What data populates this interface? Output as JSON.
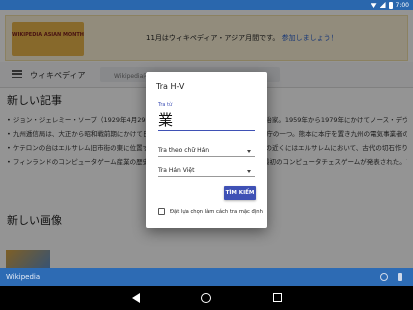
{
  "status_bar": {
    "time": "7:00"
  },
  "banner": {
    "logo_text": "WIKIPEDIA ASIAN MONTH",
    "message": "11月はウィキペディア・アジア月間です。",
    "link": "参加しましょう！"
  },
  "wiki_header": {
    "title": "ウィキペディア",
    "search_placeholder": "Wikipedia内を検索"
  },
  "news": {
    "heading": "新しい記事",
    "items": [
      {
        "text": "ジョン・ジェレミー・ソープ（1929年4月29日 - 2014年12月4日）は、イギリスの政治家。1959年から1979年にかけてノース・デヴォン選挙区選出の庶民院議員、1967年から…"
      },
      {
        "text": "九州逓信局は、大正から昭和戦前期にかけて日本の通信行政を担当した逓信省の地方官庁の一つ。熊本に本庁を置き九州の電気事業者の一つ、戦前の九州における大手電力会社九州水力電気…"
      },
      {
        "text": "ケテロンの台はエルサレム旧市街の東に位置するオリーブ山の西斜面にあり、鶏鳴教会の近くにはエルサレムにおいて、古代の切石作りの墓所が最も集中していることで知られる。また…"
      },
      {
        "text": "フィンランドのコンピュータゲーム産業の歴史では、1980年代初頭にフィンランドで最初のコンピュータチェスゲームが発表された。フィンランドのコンピュータゲーム会社ではSupercell…"
      }
    ]
  },
  "images_heading": "新しい画像",
  "bottom_bar": {
    "title": "Wikipedia"
  },
  "dialog": {
    "title": "Tra H-V",
    "field_label": "Tra từ",
    "field_value": "業",
    "select_1": "Tra theo chữ Hán",
    "select_2": "Tra Hán Việt",
    "search_button": "TÌM KIẾM",
    "checkbox_label": "Đặt lựa chọn làm cách tra mặc định"
  },
  "colors": {
    "accent": "#3f51b5",
    "status_bar": "#2a67ad",
    "app_bar": "#2d6bb4"
  }
}
